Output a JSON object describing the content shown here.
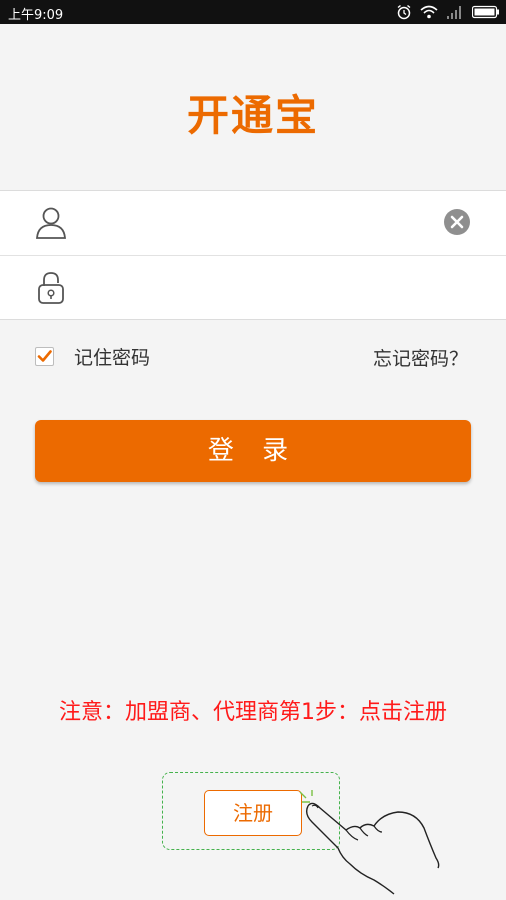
{
  "status_bar": {
    "time": "上午9:09",
    "icons": [
      "alarm-icon",
      "wifi-icon",
      "signal-icon",
      "battery-icon"
    ]
  },
  "app": {
    "logo_text": "开通宝"
  },
  "form": {
    "username": {
      "value": "",
      "placeholder": "",
      "icon": "user-icon",
      "clear_icon": "clear-icon"
    },
    "password": {
      "value": "",
      "placeholder": "",
      "icon": "lock-icon"
    }
  },
  "options": {
    "remember_label": "记住密码",
    "remember_checked": true,
    "forgot_label": "忘记密码？"
  },
  "login_button": {
    "label": "登 录"
  },
  "notice": {
    "text": "注意：加盟商、代理商第1步：点击注册"
  },
  "register_button": {
    "label": "注册"
  },
  "colors": {
    "brand": "#ec6a00",
    "notice": "#ff1a1a",
    "highlight": "#45b24c"
  }
}
